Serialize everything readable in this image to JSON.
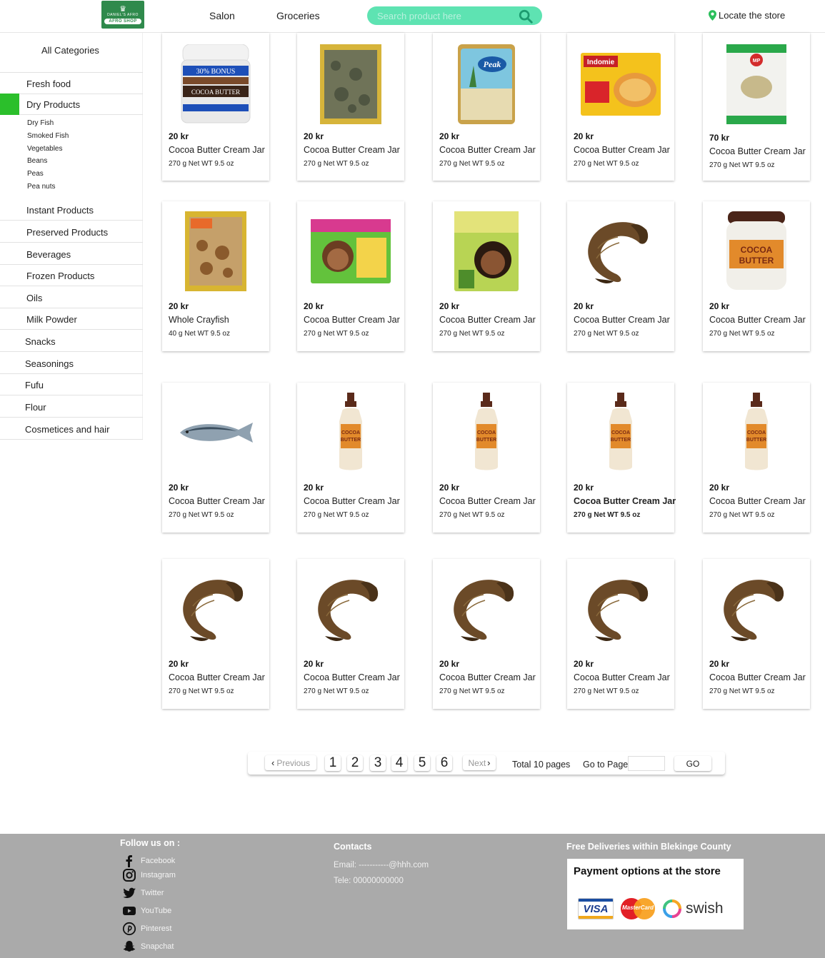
{
  "header": {
    "logo_brand": "DANIEL'S AFRO",
    "logo_ribbon": "AFRO SHOP",
    "nav": [
      "Salon",
      "Groceries"
    ],
    "search_placeholder": "Search product here",
    "locate_label": "Locate the store"
  },
  "sidebar": {
    "title": "All Categories",
    "categories_top": [
      {
        "label": "Fresh food",
        "active": false
      },
      {
        "label": "Dry Products",
        "active": true
      }
    ],
    "subcategories": [
      "Dry Fish",
      "Smoked Fish",
      "Vegetables",
      "Beans",
      "Peas",
      "Pea nuts"
    ],
    "categories_bottom": [
      "Instant Products",
      "Preserved Products",
      "Beverages",
      "Frozen Products",
      "Oils",
      "Milk Powder",
      "Snacks",
      "Seasonings",
      "Fufu",
      "Flour",
      "Cosmetices and hair"
    ]
  },
  "products": [
    {
      "price": "20 kr",
      "name": "Cocoa Butter Cream Jar",
      "weight": "270 g Net WT 9.5 oz",
      "image": "cocoa-butter-jar-icon"
    },
    {
      "price": "20 kr",
      "name": "Cocoa Butter Cream Jar",
      "weight": "270 g Net WT 9.5 oz",
      "image": "dried-leaves-pack-icon"
    },
    {
      "price": "20 kr",
      "name": "Cocoa Butter Cream Jar",
      "weight": "270 g Net WT 9.5 oz",
      "image": "milk-powder-tin-icon"
    },
    {
      "price": "20 kr",
      "name": "Cocoa Butter Cream Jar",
      "weight": "270 g Net WT 9.5 oz",
      "image": "instant-noodles-icon"
    },
    {
      "price": "70 kr",
      "name": "Cocoa Butter Cream Jar",
      "weight": "270 g Net WT 9.5 oz",
      "image": "pounded-yam-bag-icon"
    },
    {
      "price": "20 kr",
      "name": "Whole Crayfish",
      "weight": "40 g Net WT 9.5 oz",
      "image": "crayfish-pack-icon"
    },
    {
      "price": "20 kr",
      "name": "Cocoa Butter Cream Jar",
      "weight": "270 g Net WT 9.5 oz",
      "image": "kids-hair-kit-icon"
    },
    {
      "price": "20 kr",
      "name": "Cocoa Butter Cream Jar",
      "weight": "270 g Net WT 9.5 oz",
      "image": "olive-oil-hair-kit-icon"
    },
    {
      "price": "20 kr",
      "name": "Cocoa Butter Cream Jar",
      "weight": "270 g Net WT 9.5 oz",
      "image": "smoked-fish-icon"
    },
    {
      "price": "20 kr",
      "name": "Cocoa Butter Cream Jar",
      "weight": "270 g Net WT 9.5 oz",
      "image": "cocoa-butter-tub-icon"
    },
    {
      "price": "20 kr",
      "name": "Cocoa Butter Cream Jar",
      "weight": "270 g Net WT 9.5 oz",
      "image": "mackerel-fish-icon"
    },
    {
      "price": "20 kr",
      "name": "Cocoa Butter Cream Jar",
      "weight": "270 g Net WT 9.5 oz",
      "image": "lotion-bottle-icon"
    },
    {
      "price": "20 kr",
      "name": "Cocoa Butter Cream Jar",
      "weight": "270 g Net WT 9.5 oz",
      "image": "lotion-bottle-icon"
    },
    {
      "price": "20 kr",
      "name": "Cocoa Butter Cream Jar",
      "weight": "270 g Net WT 9.5 oz",
      "image": "lotion-bottle-icon",
      "bold": true
    },
    {
      "price": "20 kr",
      "name": "Cocoa Butter Cream Jar",
      "weight": "270 g Net WT 9.5 oz",
      "image": "lotion-bottle-icon"
    },
    {
      "price": "20 kr",
      "name": "Cocoa Butter Cream Jar",
      "weight": "270 g Net WT 9.5 oz",
      "image": "smoked-fish-icon"
    },
    {
      "price": "20 kr",
      "name": "Cocoa Butter Cream Jar",
      "weight": "270 g Net WT 9.5 oz",
      "image": "smoked-fish-icon"
    },
    {
      "price": "20 kr",
      "name": "Cocoa Butter Cream Jar",
      "weight": "270 g Net WT 9.5 oz",
      "image": "smoked-fish-icon"
    },
    {
      "price": "20 kr",
      "name": "Cocoa Butter Cream Jar",
      "weight": "270 g Net WT 9.5 oz",
      "image": "smoked-fish-icon"
    },
    {
      "price": "20 kr",
      "name": "Cocoa Butter Cream Jar",
      "weight": "270 g Net WT 9.5 oz",
      "image": "smoked-fish-icon"
    }
  ],
  "pagination": {
    "previous": "Previous",
    "pages": [
      "1",
      "2",
      "3",
      "4",
      "5",
      "6"
    ],
    "next": "Next",
    "total": "Total 10 pages",
    "goto_label": "Go to Page",
    "go_button": "GO"
  },
  "footer": {
    "follow_title": "Follow us on :",
    "social": [
      {
        "label": "Facebook",
        "icon": "facebook-icon"
      },
      {
        "label": "Instagram",
        "icon": "instagram-icon"
      },
      {
        "label": "Twitter",
        "icon": "twitter-icon"
      },
      {
        "label": "YouTube",
        "icon": "youtube-icon"
      },
      {
        "label": "Pinterest",
        "icon": "pinterest-icon"
      },
      {
        "label": "Snapchat",
        "icon": "snapchat-icon"
      }
    ],
    "contacts_title": "Contacts",
    "email": "Email: -----------@hhh.com",
    "phone": "Tele: 00000000000",
    "delivery_title": "Free Deliveries within Blekinge County",
    "payment_title": "Payment options at the store",
    "payment_methods": [
      "VISA",
      "MasterCard",
      "swish"
    ]
  },
  "colors": {
    "accent_green": "#2bbf2b",
    "search_bg": "#5ee3b2",
    "logo_green": "#2f8a4c",
    "footer_bg": "#aaaaaa"
  }
}
